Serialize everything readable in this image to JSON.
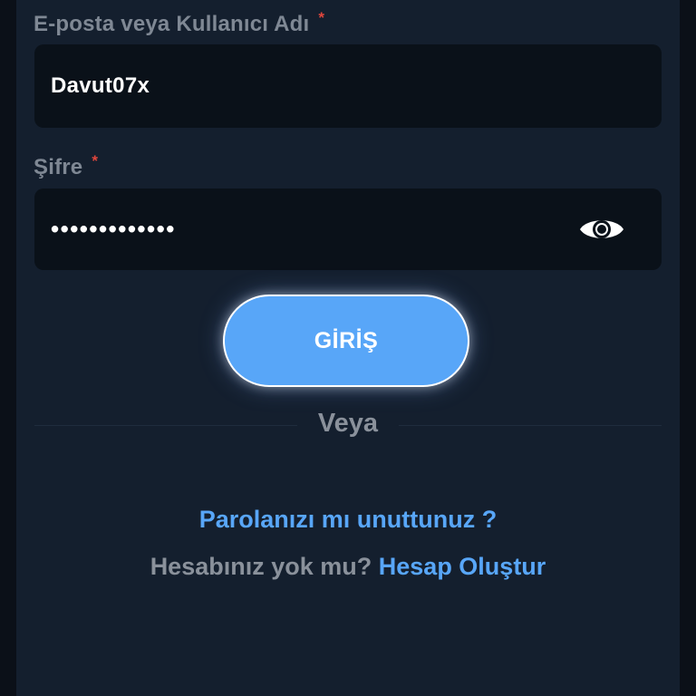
{
  "form": {
    "username_label": "E-posta veya Kullanıcı Adı",
    "username_value": "Davut07x",
    "password_label": "Şifre",
    "password_value": "•••••••••••••",
    "required_mark": "*",
    "submit_label": "GİRİŞ",
    "or_text": "Veya",
    "forgot_link": "Parolanızı mı unuttunuz ?",
    "signup_prompt": "Hesabınız yok mu?",
    "signup_link": "Hesap Oluştur"
  },
  "icons": {
    "password_toggle": "eye-icon"
  },
  "colors": {
    "background": "#141f2e",
    "field": "#0a1119",
    "accent": "#58a6f8",
    "label": "#7f8894",
    "required": "#e0463c"
  }
}
